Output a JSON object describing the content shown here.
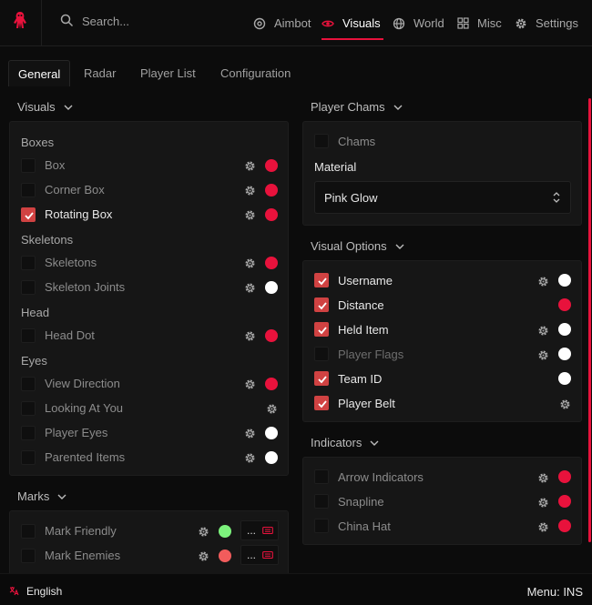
{
  "top_nav": {
    "search_placeholder": "Search...",
    "items": [
      {
        "label": "Aimbot",
        "icon": "crosshair-icon"
      },
      {
        "label": "Visuals",
        "icon": "eye-icon",
        "active": true
      },
      {
        "label": "World",
        "icon": "globe-icon"
      },
      {
        "label": "Misc",
        "icon": "grid-icon"
      },
      {
        "label": "Settings",
        "icon": "gear-icon"
      }
    ]
  },
  "sub_tabs": [
    {
      "label": "General",
      "active": true
    },
    {
      "label": "Radar"
    },
    {
      "label": "Player List"
    },
    {
      "label": "Configuration"
    }
  ],
  "left_panel": {
    "title": "Visuals",
    "groups": [
      {
        "label": "Boxes",
        "rows": [
          {
            "label": "Box",
            "checked": false,
            "color": "#e8123c"
          },
          {
            "label": "Corner Box",
            "checked": false,
            "color": "#e8123c"
          },
          {
            "label": "Rotating Box",
            "checked": true,
            "color": "#e8123c"
          }
        ]
      },
      {
        "label": "Skeletons",
        "rows": [
          {
            "label": "Skeletons",
            "checked": false,
            "color": "#e8123c"
          },
          {
            "label": "Skeleton Joints",
            "checked": false,
            "color": "#ffffff"
          }
        ]
      },
      {
        "label": "Head",
        "rows": [
          {
            "label": "Head Dot",
            "checked": false,
            "color": "#e8123c"
          }
        ]
      },
      {
        "label": "Eyes",
        "rows": [
          {
            "label": "View Direction",
            "checked": false,
            "color": "#e8123c"
          },
          {
            "label": "Looking At You",
            "checked": false,
            "color": null
          },
          {
            "label": "Player Eyes",
            "checked": false,
            "color": "#ffffff"
          },
          {
            "label": "Parented Items",
            "checked": false,
            "color": "#ffffff"
          }
        ]
      }
    ]
  },
  "marks_panel": {
    "title": "Marks",
    "rows": [
      {
        "label": "Mark Friendly",
        "checked": false,
        "color": "#7cf27c",
        "button": "..."
      },
      {
        "label": "Mark Enemies",
        "checked": false,
        "color": "#f25c5c",
        "button": "..."
      }
    ]
  },
  "player_chams": {
    "title": "Player Chams",
    "chams_label": "Chams",
    "chams_checked": false,
    "material_label": "Material",
    "material_value": "Pink Glow"
  },
  "visual_options": {
    "title": "Visual Options",
    "rows": [
      {
        "label": "Username",
        "checked": true,
        "gear": true,
        "color": "#ffffff"
      },
      {
        "label": "Distance",
        "checked": true,
        "gear": false,
        "color": "#e8123c"
      },
      {
        "label": "Held Item",
        "checked": true,
        "gear": true,
        "color": "#ffffff"
      },
      {
        "label": "Player Flags",
        "checked": false,
        "gear": true,
        "color": "#ffffff"
      },
      {
        "label": "Team ID",
        "checked": true,
        "gear": false,
        "color": "#ffffff"
      },
      {
        "label": "Player Belt",
        "checked": true,
        "gear": true,
        "color": null
      }
    ]
  },
  "indicators": {
    "title": "Indicators",
    "rows": [
      {
        "label": "Arrow Indicators",
        "checked": false,
        "color": "#e8123c"
      },
      {
        "label": "Snapline",
        "checked": false,
        "color": "#e8123c"
      },
      {
        "label": "China Hat",
        "checked": false,
        "color": "#e8123c"
      }
    ]
  },
  "footer": {
    "language": "English",
    "menu_hint": "Menu: INS"
  },
  "colors": {
    "accent": "#e8123c",
    "checkbox_on": "#d04242"
  }
}
